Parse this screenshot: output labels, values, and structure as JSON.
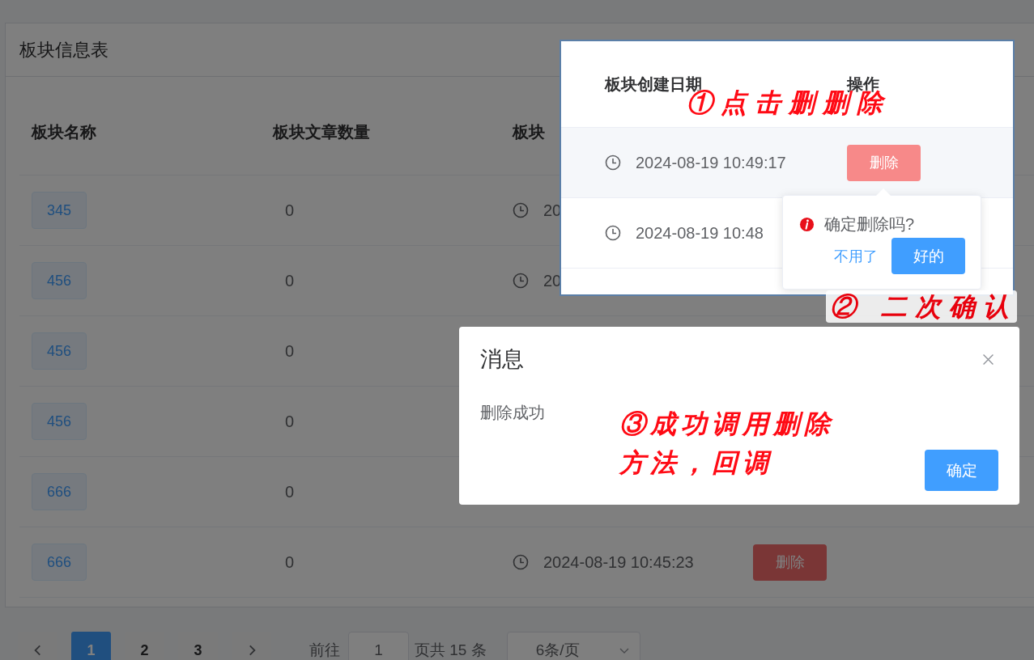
{
  "panel": {
    "title": "板块信息表"
  },
  "table": {
    "columns": [
      "板块名称",
      "板块文章数量",
      "板块"
    ],
    "rows": [
      {
        "name": "345",
        "count": "0",
        "date": "20"
      },
      {
        "name": "456",
        "count": "0",
        "date": "20"
      },
      {
        "name": "456",
        "count": "0"
      },
      {
        "name": "456",
        "count": "0"
      },
      {
        "name": "666",
        "count": "0"
      },
      {
        "name": "666",
        "count": "0",
        "date": "2024-08-19 10:45:23",
        "action": "删除"
      }
    ]
  },
  "pagination": {
    "pages": [
      {
        "label": "1",
        "selected": true
      },
      {
        "label": "2",
        "selected": false
      },
      {
        "label": "3",
        "selected": false
      }
    ],
    "goto_label": "前往",
    "goto_value": "1",
    "total": "页共 15 条",
    "page_size": "6条/页"
  },
  "inset": {
    "columns": [
      "板块创建日期",
      "操作"
    ],
    "rows": [
      {
        "date": "2024-08-19 10:49:17",
        "action": "删除",
        "hovered": true
      },
      {
        "date": "2024-08-19 10:48"
      }
    ],
    "popconfirm": {
      "title": "确定删除吗?",
      "cancel": "不用了",
      "confirm": "好的"
    }
  },
  "dialog": {
    "title": "消息",
    "message": "删除成功",
    "confirm": "确定"
  },
  "annotations": [
    {
      "lines": [
        "①点击删删除"
      ]
    },
    {
      "lines": [
        "② 二次确认"
      ]
    },
    {
      "lines": [
        "③成功调用删除",
        "方法，回调"
      ]
    }
  ]
}
